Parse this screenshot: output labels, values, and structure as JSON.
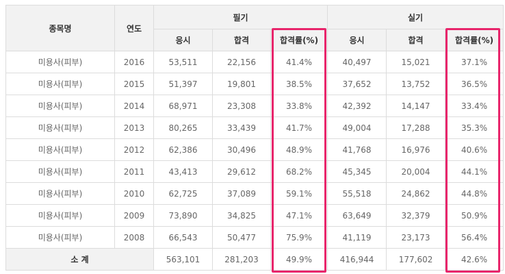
{
  "table": {
    "headers": {
      "subject": "종목명",
      "year": "연도",
      "written": "필기",
      "practical": "실기",
      "written_cols": [
        "응시",
        "합격",
        "합격률(%)"
      ],
      "practical_cols": [
        "응시",
        "합격",
        "합격률(%)"
      ]
    },
    "rows": [
      [
        "미용사(피부)",
        "2016",
        "53,511",
        "22,156",
        "41.4%",
        "40,497",
        "15,021",
        "37.1%"
      ],
      [
        "미용사(피부)",
        "2015",
        "51,397",
        "19,801",
        "38.5%",
        "37,652",
        "13,752",
        "36.5%"
      ],
      [
        "미용사(피부)",
        "2014",
        "68,971",
        "23,308",
        "33.8%",
        "42,392",
        "14,147",
        "33.4%"
      ],
      [
        "미용사(피부)",
        "2013",
        "80,265",
        "33,439",
        "41.7%",
        "49,004",
        "17,288",
        "35.3%"
      ],
      [
        "미용사(피부)",
        "2012",
        "62,386",
        "30,496",
        "48.9%",
        "41,768",
        "16,976",
        "40.6%"
      ],
      [
        "미용사(피부)",
        "2011",
        "43,413",
        "29,612",
        "68.2%",
        "45,345",
        "20,004",
        "44.1%"
      ],
      [
        "미용사(피부)",
        "2010",
        "62,725",
        "37,089",
        "59.1%",
        "55,518",
        "24,862",
        "44.8%"
      ],
      [
        "미용사(피부)",
        "2009",
        "73,890",
        "34,825",
        "47.1%",
        "63,649",
        "32,379",
        "50.9%"
      ],
      [
        "미용사(피부)",
        "2008",
        "66,543",
        "50,477",
        "75.9%",
        "41,119",
        "23,173",
        "56.4%"
      ]
    ],
    "total": {
      "label": "소 계",
      "values": [
        "563,101",
        "281,203",
        "49.9%",
        "416,944",
        "177,602",
        "42.6%"
      ]
    }
  },
  "colors": {
    "highlight": "#e8256b",
    "header_bg": "#f2f2f2",
    "border": "#dcdcdc"
  }
}
